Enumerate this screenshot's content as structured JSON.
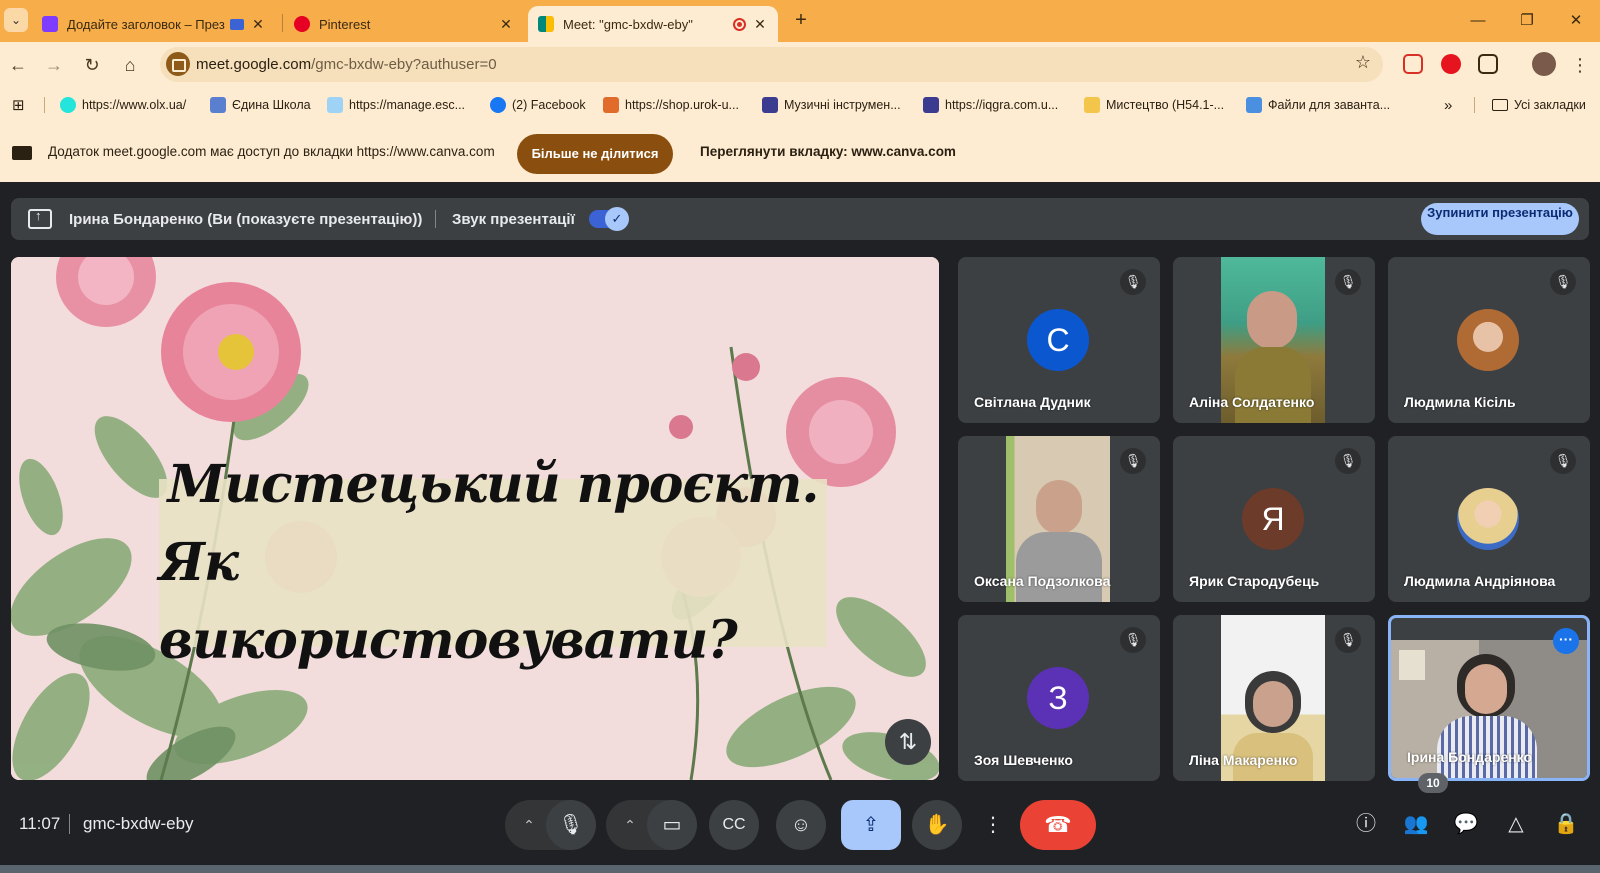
{
  "browser": {
    "tabs": [
      {
        "label": "Додайте заголовок – През",
        "favicon_color": "#7d3cff",
        "active": false
      },
      {
        "label": "Pinterest",
        "favicon_color": "#e60023",
        "active": false
      },
      {
        "label": "Meet: \"gmc-bxdw-eby\"",
        "favicon_color": "#00897b",
        "active": true
      }
    ],
    "new_tab": "+",
    "window_controls": {
      "minimize": "—",
      "restore": "❐",
      "close": "✕"
    },
    "url": {
      "host": "meet.google.com",
      "path": "/gmc-bxdw-eby?authuser=0"
    },
    "bookmarks": [
      {
        "label": "https://www.olx.ua/",
        "color": "#23e5db"
      },
      {
        "label": "Єдина Школа",
        "color": "#5b7fcf"
      },
      {
        "label": "https://manage.esc...",
        "color": "#9fd3f5"
      },
      {
        "label": "(2) Facebook",
        "color": "#1877f2"
      },
      {
        "label": "https://shop.urok-u...",
        "color": "#e06b2b"
      },
      {
        "label": "Музичні інструмен...",
        "color": "#3b3b8f"
      },
      {
        "label": "https://iqgra.com.u...",
        "color": "#3b3b8f"
      },
      {
        "label": "Мистецтво (Н54.1-...",
        "color": "#f3c54a"
      },
      {
        "label": "Файли для завантa...",
        "color": "#4a8fe0"
      }
    ],
    "bookmarks_overflow": "»",
    "all_bookmarks": "Усі закладки",
    "infobar": {
      "text": "Додаток meet.google.com має доступ до вкладки https://www.canva.com",
      "stop_button": "Більше не ділитися",
      "view_tab": "Переглянути вкладку: www.canva.com"
    }
  },
  "meet": {
    "presenting_label": "Ірина Бондаренко (Ви (показуєте презентацію))",
    "audio_label": "Звук презентації",
    "audio_on": true,
    "stop_button": "Зупинити презентацію",
    "slide": {
      "title_line1": "Мистецький проєкт.",
      "title_line2": "Як використовувати?"
    },
    "participants": [
      {
        "name": "Світлана Дудник",
        "type": "avatar",
        "initial": "С",
        "color": "#0b57d0",
        "muted": true
      },
      {
        "name": "Аліна Солдатенко",
        "type": "video",
        "muted": true
      },
      {
        "name": "Людмила Кісіль",
        "type": "photo",
        "muted": true
      },
      {
        "name": "Оксана Подзолкова",
        "type": "video",
        "muted": true
      },
      {
        "name": "Ярик Стародубець",
        "type": "avatar",
        "initial": "Я",
        "color": "#6d3b2a",
        "muted": true
      },
      {
        "name": "Людмила Андріянова",
        "type": "photo",
        "muted": true
      },
      {
        "name": "Зоя Шевченко",
        "type": "avatar",
        "initial": "З",
        "color": "#5b32b5",
        "muted": true
      },
      {
        "name": "Ліна Макаренко",
        "type": "video",
        "muted": true
      },
      {
        "name": "Ірина Бондаренко",
        "type": "self",
        "muted": false
      }
    ],
    "clock": "11:07",
    "meeting_code": "gmc-bxdw-eby",
    "people_count": "10"
  }
}
